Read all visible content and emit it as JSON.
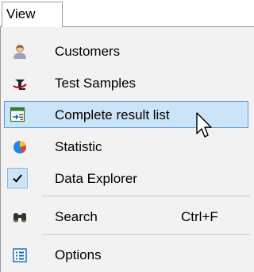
{
  "menubar": {
    "menu_title": "View"
  },
  "menu": {
    "items": [
      {
        "label": "Customers",
        "icon": "customer-icon"
      },
      {
        "label": "Test Samples",
        "icon": "test-samples-icon"
      },
      {
        "label": "Complete result list",
        "icon": "result-list-icon",
        "highlighted": true
      },
      {
        "label": "Statistic",
        "icon": "statistic-icon"
      },
      {
        "label": "Data Explorer",
        "icon": "checkmark-icon",
        "checked": true
      },
      {
        "label": "Search",
        "shortcut": "Ctrl+F",
        "icon": "binoculars-icon"
      },
      {
        "label": "Options",
        "icon": "options-icon"
      }
    ]
  },
  "colors": {
    "highlight_fill": "#cce4f7",
    "highlight_border": "#5b9bd5",
    "menu_background": "#f2f2f2"
  }
}
